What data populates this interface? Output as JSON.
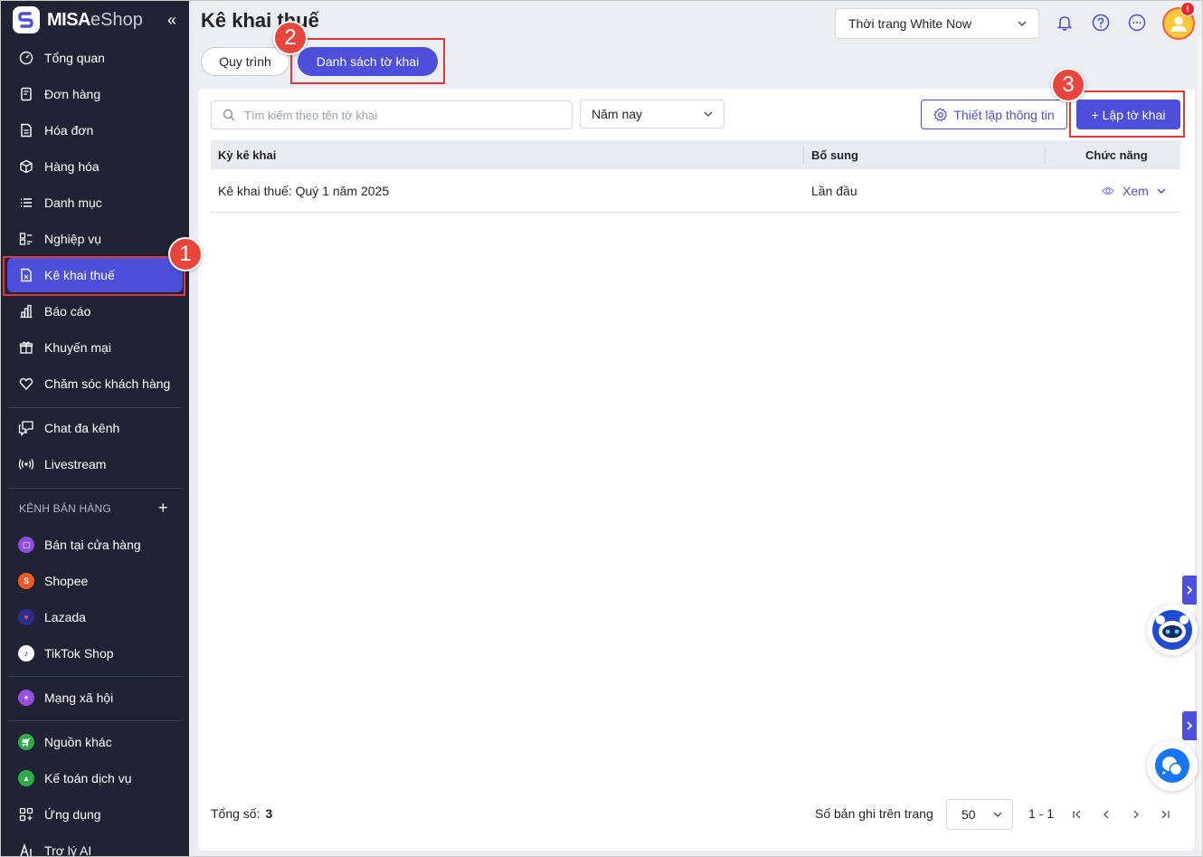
{
  "brand": {
    "logo_bold": "MISA",
    "logo_light": "eShop"
  },
  "sidebar": {
    "collapse_glyph": "«",
    "items": [
      {
        "label": "Tổng quan",
        "icon": "dashboard-icon"
      },
      {
        "label": "Đơn hàng",
        "icon": "order-icon"
      },
      {
        "label": "Hóa đơn",
        "icon": "invoice-icon"
      },
      {
        "label": "Hàng hóa",
        "icon": "box-icon"
      },
      {
        "label": "Danh mục",
        "icon": "list-icon"
      },
      {
        "label": "Nghiệp vụ",
        "icon": "operations-icon"
      },
      {
        "label": "Kê khai thuế",
        "icon": "tax-icon",
        "active": true
      },
      {
        "label": "Báo cáo",
        "icon": "report-icon"
      },
      {
        "label": "Khuyến mại",
        "icon": "gift-icon"
      },
      {
        "label": "Chăm sóc khách hàng",
        "icon": "heart-icon"
      },
      {
        "label": "Chat đa kênh",
        "icon": "chat-icon"
      },
      {
        "label": "Livestream",
        "icon": "livestream-icon"
      }
    ],
    "section_title": "KÊNH BÁN HÀNG",
    "section_plus": "+",
    "channels": [
      {
        "label": "Bán tại cửa hàng",
        "color": "#8f4ee0",
        "icon": "store-icon"
      },
      {
        "label": "Shopee",
        "color": "#f05a24",
        "icon": "shopee-icon"
      },
      {
        "label": "Lazada",
        "color": "#2b2e8f",
        "icon": "lazada-icon"
      },
      {
        "label": "TikTok Shop",
        "color": "#ffffff",
        "icon": "tiktok-icon"
      },
      {
        "label": "Mạng xã hội",
        "color": "#9b4fe0",
        "icon": "social-icon"
      },
      {
        "label": "Nguồn khác",
        "color": "#2faa4a",
        "icon": "cart-icon"
      },
      {
        "label": "Kế toán dịch vụ",
        "color": "#2faa4a",
        "icon": "accounting-icon"
      },
      {
        "label": "Ứng dụng",
        "icon": "apps-icon"
      },
      {
        "label": "Trợ lý AI",
        "icon": "ai-icon"
      }
    ]
  },
  "header": {
    "title": "Kê khai thuế",
    "tabs": [
      {
        "label": "Quy trình"
      },
      {
        "label": "Danh sách tờ khai"
      }
    ],
    "store_select": "Thời trang White Now",
    "avatar_badge": "!"
  },
  "toolbar": {
    "search_placeholder": "Tìm kiếm theo tên tờ khai",
    "year_select": "Năm nay",
    "setup_label": "Thiết lập thông tin",
    "create_label": "+ Lập tờ khai"
  },
  "table": {
    "columns": [
      "Kỳ kê khai",
      "Bổ sung",
      "Chức năng"
    ],
    "rows": [
      {
        "period": "Kê khai thuế: Quý 1 năm 2025",
        "supplement": "Lần đầu",
        "action": "Xem"
      }
    ]
  },
  "footer": {
    "total_label": "Tổng số:",
    "total_value": "3",
    "per_page_label": "Số bản ghi trên trang",
    "per_page_value": "50",
    "range": "1 - 1"
  },
  "callouts": [
    "1",
    "2",
    "3"
  ],
  "colors": {
    "accent": "#4b4fd9",
    "sidebar_bg": "#1f2333",
    "callout": "#e0383b"
  }
}
